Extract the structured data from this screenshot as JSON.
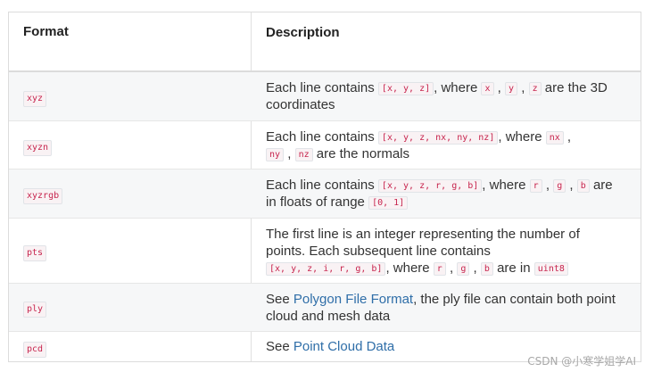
{
  "header": {
    "format": "Format",
    "description": "Description"
  },
  "rows": [
    {
      "format": "xyz",
      "t1": "Each line contains ",
      "c1": "[x, y, z]",
      "t2": ", where ",
      "c2": "x",
      "t3": " , ",
      "c3": "y",
      "t4": " , ",
      "c4": "z",
      "t5": " are the 3D coordinates"
    },
    {
      "format": "xyzn",
      "t1": "Each line contains ",
      "c1": "[x, y, z, nx, ny, nz]",
      "t2": ", where ",
      "c2": "nx",
      "t3": " ,",
      "c3": "ny",
      "t4": " , ",
      "c4": "nz",
      "t5": " are the normals"
    },
    {
      "format": "xyzrgb",
      "t1": "Each line contains ",
      "c1": "[x, y, z, r, g, b]",
      "t2": ", where ",
      "c2": "r",
      "t3": " , ",
      "c3": "g",
      "t4": " , ",
      "c4": "b",
      "t5": " are in floats of range ",
      "c5": "[0, 1]"
    },
    {
      "format": "pts",
      "t1": "The first line is an integer representing the number of points. Each subsequent line contains ",
      "c1": "[x, y, z, i, r, g, b]",
      "t2": ", where ",
      "c2": "r",
      "t3": " , ",
      "c3": "g",
      "t4": " , ",
      "c4": "b",
      "t5": " are in ",
      "c5": "uint8"
    },
    {
      "format": "ply",
      "t1": "See ",
      "link": "Polygon File Format",
      "t2": ", the ply file can contain both point cloud and mesh data"
    },
    {
      "format": "pcd",
      "t1": "See ",
      "link": "Point Cloud Data"
    }
  ],
  "watermark": "CSDN @小寒学姐学AI",
  "colors": {
    "link": "#2f6ea8",
    "code_text": "#c7254e",
    "row_shade": "#f6f7f8"
  }
}
